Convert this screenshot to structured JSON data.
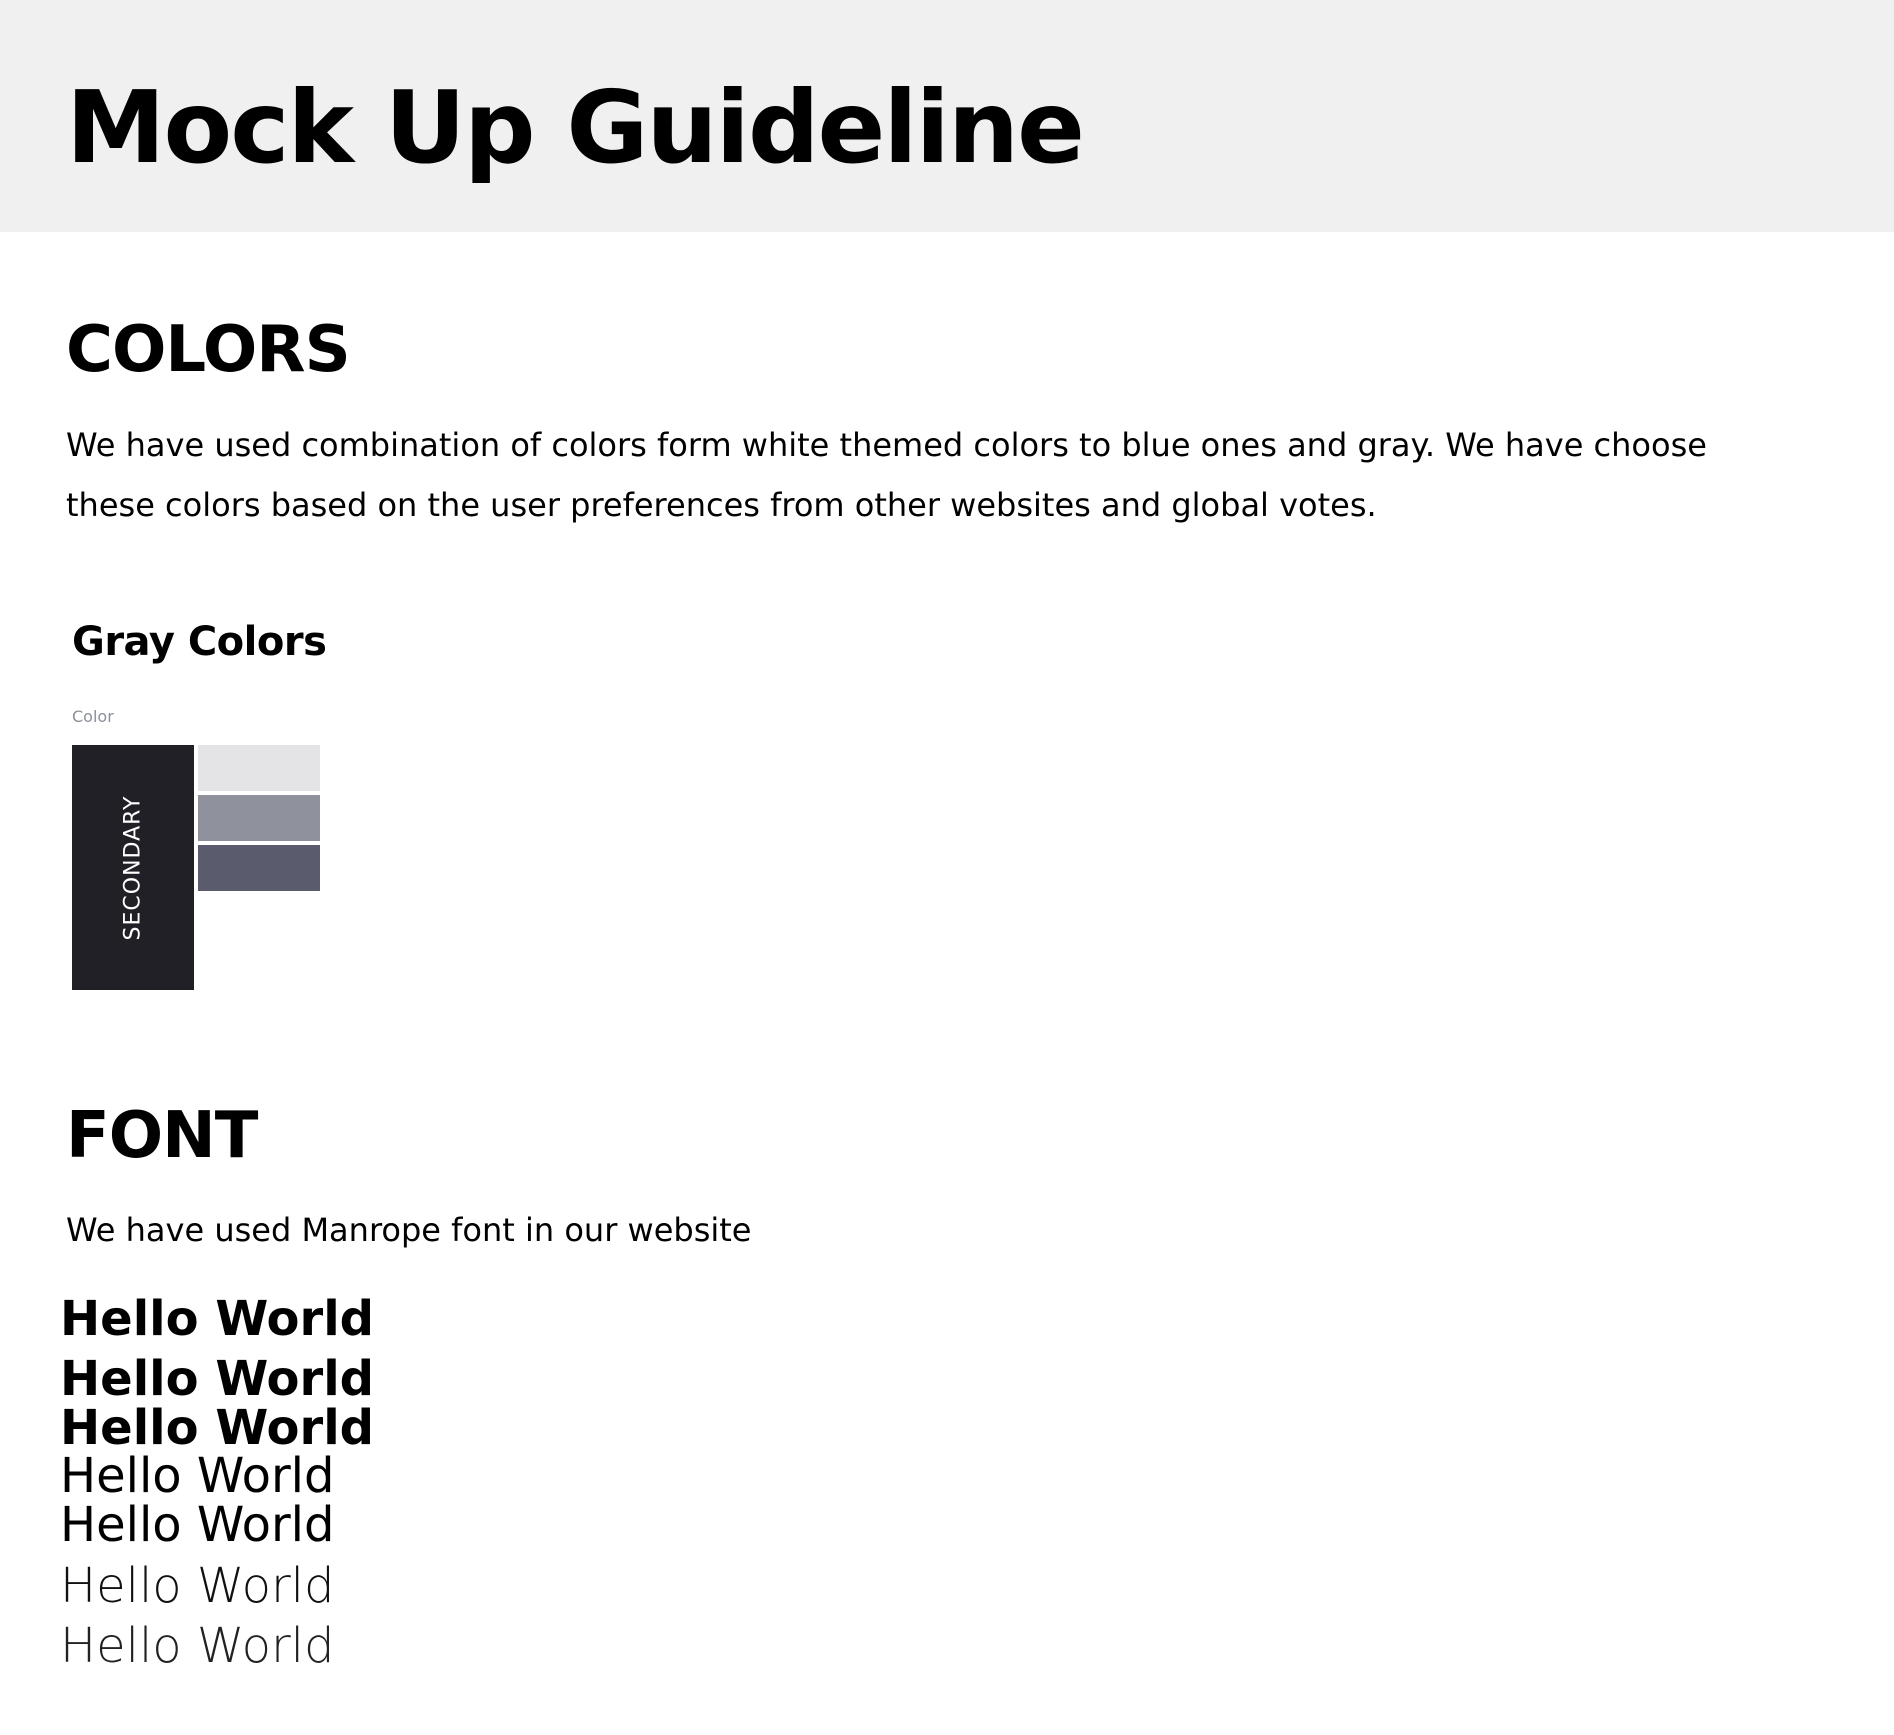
{
  "header": {
    "title": "Mock Up Guideline"
  },
  "colors": {
    "title": "COLORS",
    "description": "We have used combination of colors form white themed colors to blue ones and gray. We have choose these colors based on the user preferences from other websites and global votes.",
    "gray": {
      "title": "Gray Colors",
      "caption": "Color",
      "main": {
        "label": "SECONDARY",
        "color": "#212026"
      },
      "shades": [
        "#e4e4e6",
        "#8f929d",
        "#5a5b6c"
      ]
    }
  },
  "font": {
    "title": "FONT",
    "description": "We have used Manrope font in our website",
    "samples": [
      "Hello World",
      "Hello World",
      "Hello World",
      "Hello World",
      "Hello World",
      "Hello World",
      "Hello World"
    ]
  }
}
